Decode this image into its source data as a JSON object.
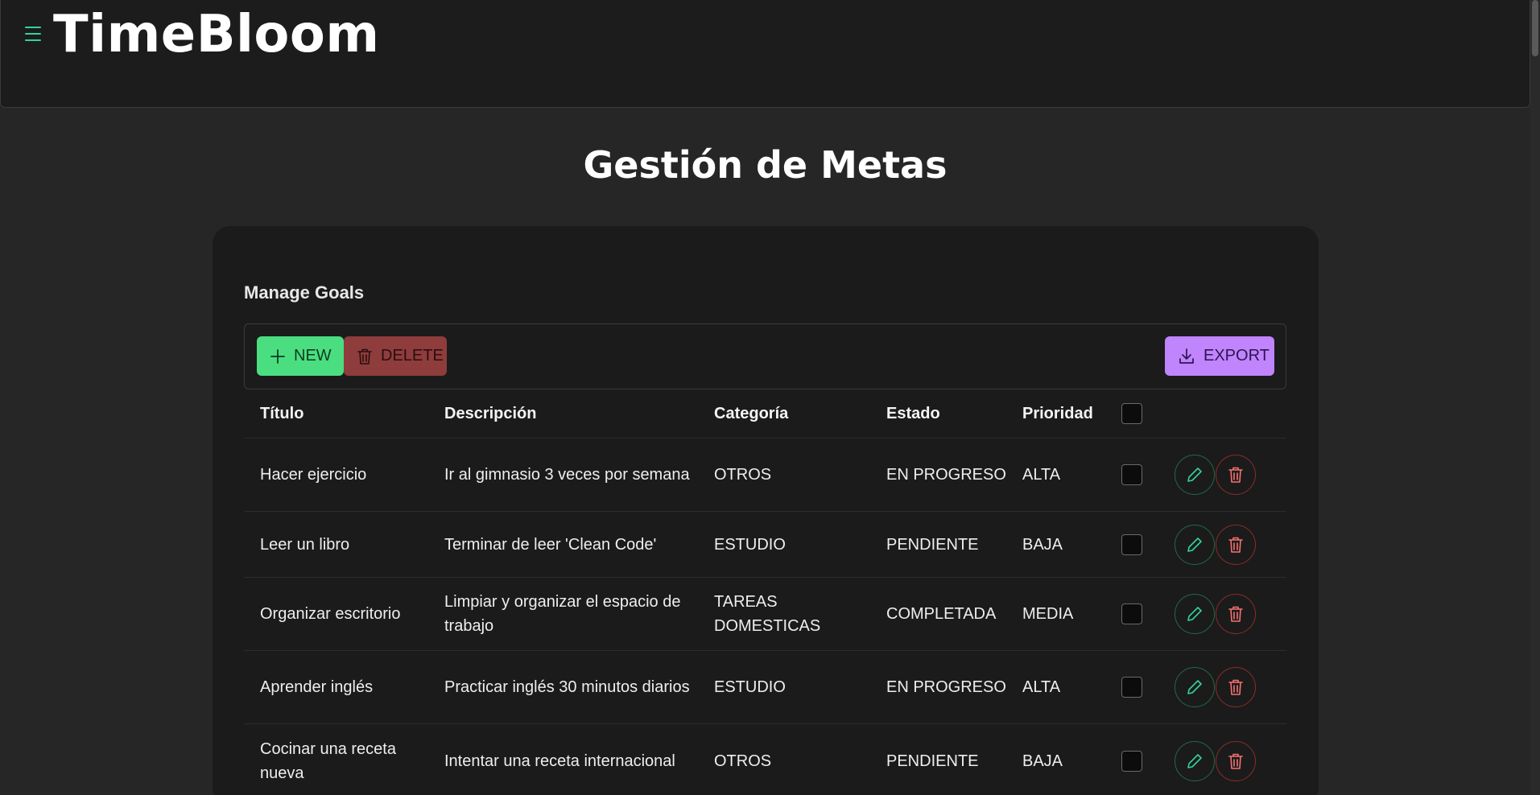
{
  "app": {
    "brand": "TimeBloom"
  },
  "page": {
    "title": "Gestión de Metas"
  },
  "card": {
    "title": "Manage Goals"
  },
  "toolbar": {
    "new_label": "NEW",
    "delete_label": "DELETE",
    "export_label": "EXPORT"
  },
  "table": {
    "columns": [
      "Título",
      "Descripción",
      "Categoría",
      "Estado",
      "Prioridad"
    ],
    "rows": [
      {
        "titulo": "Hacer ejercicio",
        "descripcion": "Ir al gimnasio 3 veces por semana",
        "categoria": "OTROS",
        "estado": "EN PROGRESO",
        "prioridad": "ALTA"
      },
      {
        "titulo": "Leer un libro",
        "descripcion": "Terminar de leer 'Clean Code'",
        "categoria": "ESTUDIO",
        "estado": "PENDIENTE",
        "prioridad": "BAJA"
      },
      {
        "titulo": "Organizar escritorio",
        "descripcion": "Limpiar y organizar el espacio de trabajo",
        "categoria": "TAREAS DOMESTICAS",
        "estado": "COMPLETADA",
        "prioridad": "MEDIA"
      },
      {
        "titulo": "Aprender inglés",
        "descripcion": "Practicar inglés 30 minutos diarios",
        "categoria": "ESTUDIO",
        "estado": "EN PROGRESO",
        "prioridad": "ALTA"
      },
      {
        "titulo": "Cocinar una receta nueva",
        "descripcion": "Intentar una receta internacional",
        "categoria": "OTROS",
        "estado": "PENDIENTE",
        "prioridad": "BAJA"
      }
    ]
  },
  "icons": {
    "menu": "hamburger-icon",
    "new": "plus-icon",
    "delete": "trash-icon",
    "export": "download-icon",
    "edit": "pencil-icon"
  },
  "colors": {
    "accent_green": "#4ade80",
    "delete_red": "#8f3c3c",
    "export_purple": "#c084fc",
    "edit_icon": "#34d399",
    "trash_icon": "#f87171"
  }
}
